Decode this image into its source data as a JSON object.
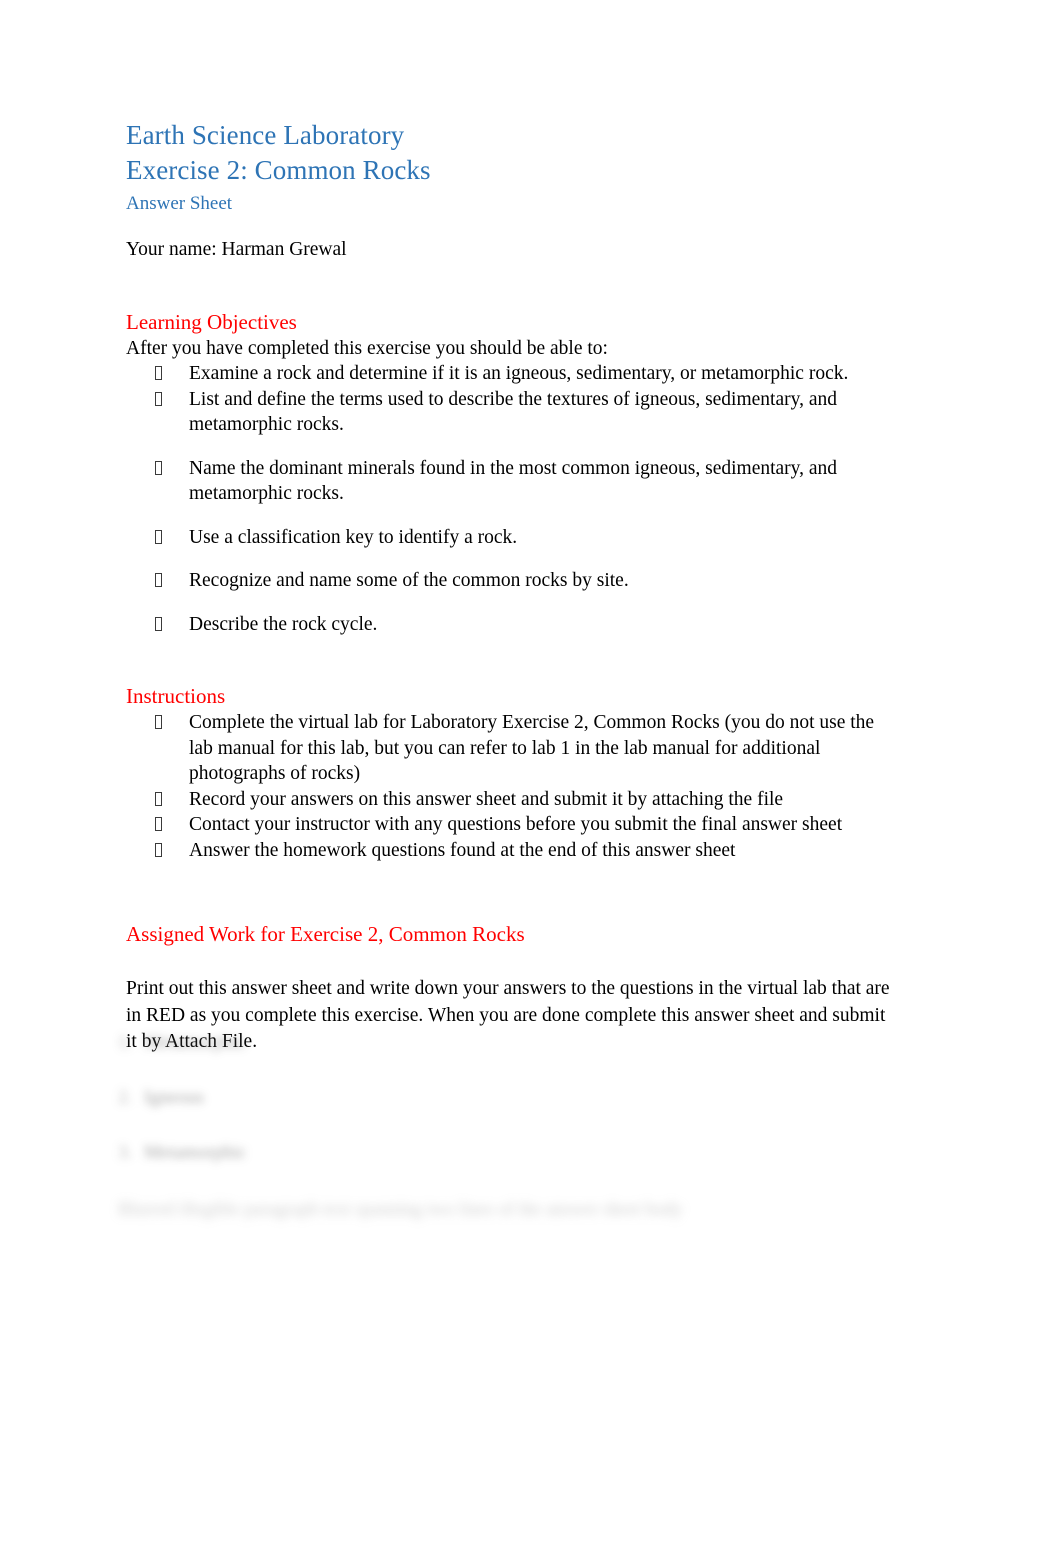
{
  "document": {
    "title_line_1": "Earth Science Laboratory",
    "title_line_2": "Exercise 2: Common Rocks",
    "subtitle": "Answer Sheet",
    "name_line": "Your name: Harman Grewal",
    "colors": {
      "heading_blue": "#2E74B5",
      "heading_red": "#FF0000",
      "body_text": "#000000",
      "page_background": "#FFFFFF"
    }
  },
  "learning_objectives": {
    "heading": "Learning Objectives",
    "lead_in": "After you have completed this exercise you should be able to:",
    "bullet_icon": "notdef-box-bullet",
    "items": [
      "Examine a rock and determine if it is an igneous, sedimentary, or metamorphic rock.",
      "List and define the terms used to describe the textures of igneous, sedimentary, and metamorphic rocks.",
      "Name the dominant minerals found in the most common igneous, sedimentary, and metamorphic rocks.",
      "Use a classification key to identify a rock.",
      "Recognize and name some of the common rocks by site.",
      "Describe the rock cycle."
    ]
  },
  "instructions": {
    "heading": "Instructions",
    "bullet_icon": "notdef-box-bullet",
    "items": [
      "Complete the virtual lab for Laboratory Exercise 2, Common Rocks (you do not use the lab manual for this lab, but you can refer to lab 1 in the lab manual for additional photographs of rocks)",
      "Record your answers on this answer sheet and submit it by attaching the file",
      "Contact your instructor with any questions before you submit the final answer sheet",
      "Answer the homework questions found at the end of this answer sheet"
    ]
  },
  "assigned_work": {
    "heading": "Assigned Work for Exercise 2, Common Rocks",
    "paragraph": "Print out this answer sheet and write down your answers to the questions in the virtual lab that are in RED as you complete this exercise. When you are done complete this answer sheet and submit it by Attach File."
  },
  "redacted_region": {
    "note": "blurred-illegible",
    "answers": [
      {
        "number": "1.",
        "text": "Metamorphic"
      },
      {
        "number": "2.",
        "text": "Igneous"
      },
      {
        "number": "3.",
        "text": "Metamorphic"
      }
    ],
    "paragraph": "Blurred illegible paragraph text spanning two lines of the answer sheet body"
  }
}
